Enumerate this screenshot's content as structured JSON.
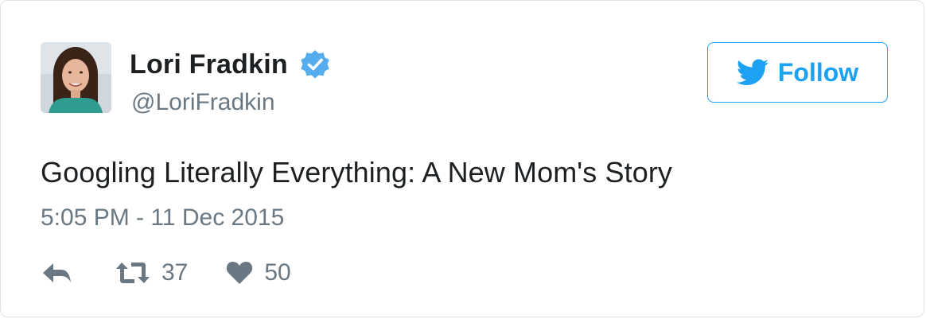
{
  "tweet": {
    "author": {
      "display_name": "Lori Fradkin",
      "handle": "@LoriFradkin",
      "verified": true
    },
    "follow_label": "Follow",
    "text": "Googling Literally Everything: A New Mom's Story",
    "timestamp": "5:05 PM - 11 Dec 2015",
    "actions": {
      "retweet_count": "37",
      "like_count": "50"
    }
  },
  "icons": {
    "verified": "verified-badge-icon",
    "follow": "twitter-bird-icon",
    "reply": "reply-icon",
    "retweet": "retweet-icon",
    "like": "heart-icon"
  },
  "colors": {
    "brand_blue": "#1da1f2",
    "verified_blue": "#55acee",
    "text_primary": "#1c2022",
    "text_secondary": "#697882",
    "border": "#dfe3e8"
  }
}
